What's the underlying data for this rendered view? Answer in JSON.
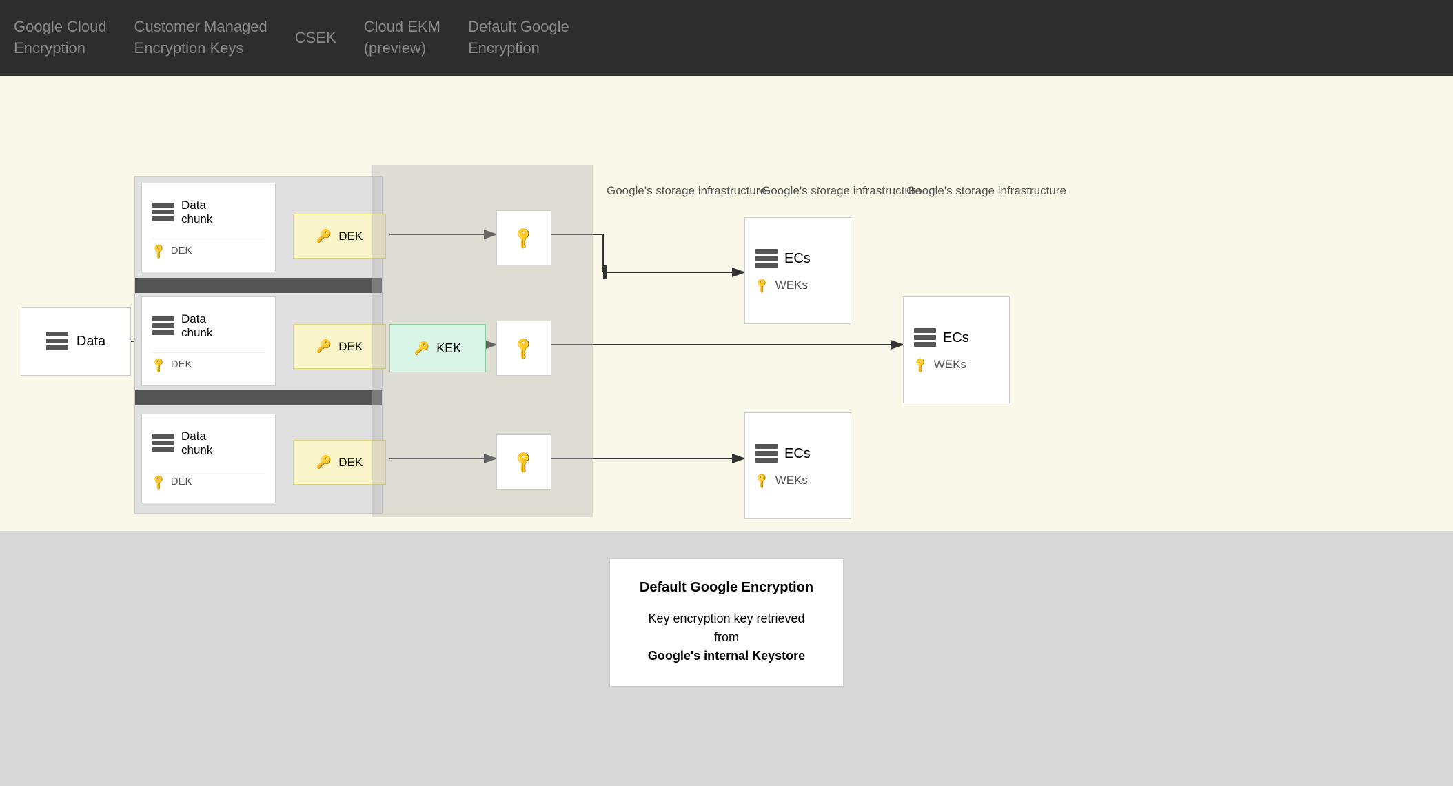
{
  "topBar": {
    "segments": [
      {
        "text": "Google Cloud\nEncryption",
        "cols": 1
      },
      {
        "text": "Customer Managed\nEncryption Keys",
        "cols": 1
      },
      {
        "text": "CSEK",
        "cols": 1
      },
      {
        "text": "Cloud EKM\n(preview)",
        "cols": 1
      },
      {
        "text": "Default Google\nEncryption",
        "cols": 1
      }
    ]
  },
  "diagram": {
    "dataBox": {
      "label": "Data"
    },
    "chunks": [
      {
        "title": "Data chunk",
        "dek": "DEK",
        "dekBoxLabel": "DEK"
      },
      {
        "title": "Data chunk",
        "dek": "DEK",
        "dekBoxLabel": "DEK"
      },
      {
        "title": "Data chunk",
        "dek": "DEK",
        "dekBoxLabel": "DEK"
      }
    ],
    "kek": {
      "label": "KEK"
    },
    "infraLabels": [
      {
        "text": "Google's storage\ninfrastructure"
      },
      {
        "text": "Google's storage\ninfrastructure"
      },
      {
        "text": "Google's storage\ninfrastructure"
      }
    ],
    "storageBoxes": [
      {
        "ecs": "ECs",
        "weks": "WEKs"
      },
      {
        "ecs": "ECs",
        "weks": "WEKs"
      },
      {
        "ecs": "ECs",
        "weks": "WEKs"
      }
    ]
  },
  "legend": {
    "title": "Default Google Encryption",
    "description": "Key encryption key retrieved from\nGoogle's internal Keystore"
  }
}
